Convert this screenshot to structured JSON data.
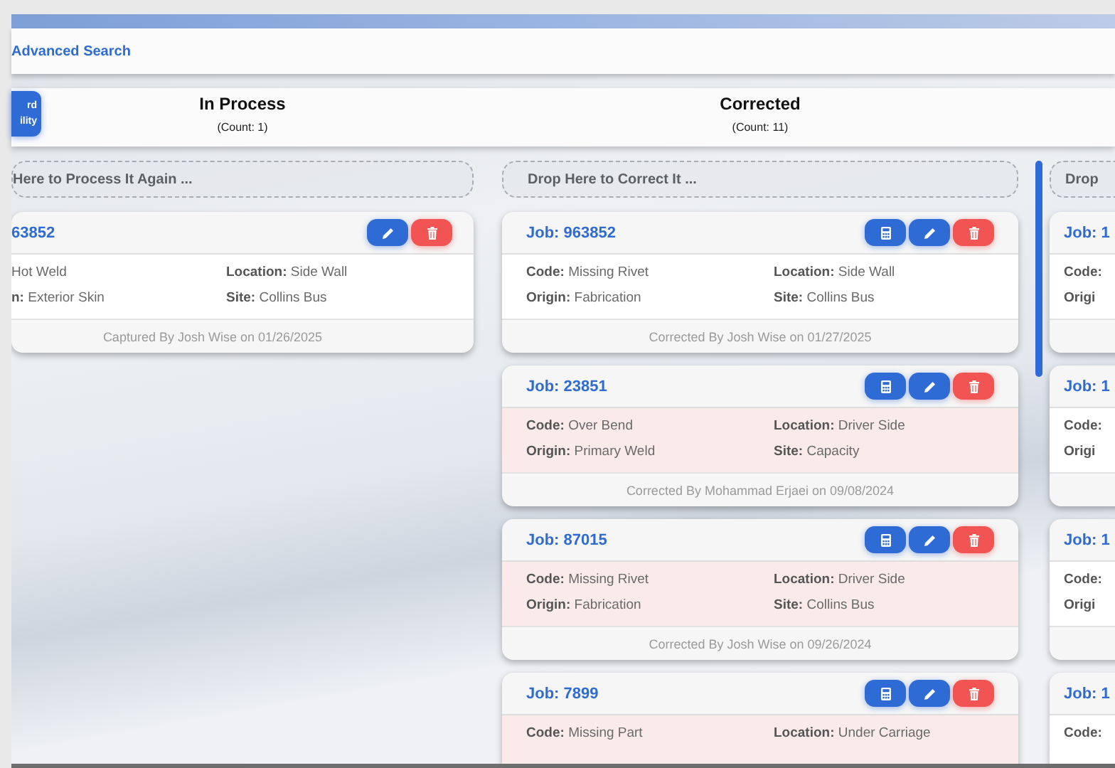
{
  "top_bar": {
    "link": "Advanced Search"
  },
  "side_button": {
    "lines": [
      "rd",
      "ility"
    ]
  },
  "columns": [
    {
      "title": "In Process",
      "count": "(Count: 1)",
      "drop_hint": "Here to Process It Again ...",
      "cards": [
        {
          "title": "63852",
          "highlighted": false,
          "actions": [
            {
              "kind": "edit"
            },
            {
              "kind": "delete"
            }
          ],
          "rows": [
            [
              {
                "value": "Hot Weld"
              },
              {
                "label": "Location:",
                "value": "Side Wall"
              }
            ],
            [
              {
                "label": "n:",
                "value": "Exterior Skin"
              },
              {
                "label": "Site:",
                "value": "Collins Bus"
              }
            ]
          ],
          "footer": "Captured By Josh Wise on 01/26/2025"
        }
      ]
    },
    {
      "title": "Corrected",
      "count": "(Count: 11)",
      "drop_hint": "Drop Here to Correct It ...",
      "cards": [
        {
          "title": "Job: 963852",
          "highlighted": false,
          "actions": [
            {
              "kind": "calculate"
            },
            {
              "kind": "edit"
            },
            {
              "kind": "delete"
            }
          ],
          "rows": [
            [
              {
                "label": "Code:",
                "value": "Missing Rivet"
              },
              {
                "label": "Location:",
                "value": "Side Wall"
              }
            ],
            [
              {
                "label": "Origin:",
                "value": "Fabrication"
              },
              {
                "label": "Site:",
                "value": "Collins Bus"
              }
            ]
          ],
          "footer": "Corrected By Josh Wise on 01/27/2025"
        },
        {
          "title": "Job: 23851",
          "highlighted": true,
          "actions": [
            {
              "kind": "calculate"
            },
            {
              "kind": "edit"
            },
            {
              "kind": "delete"
            }
          ],
          "rows": [
            [
              {
                "label": "Code:",
                "value": "Over Bend"
              },
              {
                "label": "Location:",
                "value": "Driver Side"
              }
            ],
            [
              {
                "label": "Origin:",
                "value": "Primary Weld"
              },
              {
                "label": "Site:",
                "value": "Capacity"
              }
            ]
          ],
          "footer": "Corrected By Mohammad Erjaei on 09/08/2024"
        },
        {
          "title": "Job: 87015",
          "highlighted": true,
          "actions": [
            {
              "kind": "calculate"
            },
            {
              "kind": "edit"
            },
            {
              "kind": "delete"
            }
          ],
          "rows": [
            [
              {
                "label": "Code:",
                "value": "Missing Rivet"
              },
              {
                "label": "Location:",
                "value": "Driver Side"
              }
            ],
            [
              {
                "label": "Origin:",
                "value": "Fabrication"
              },
              {
                "label": "Site:",
                "value": "Collins Bus"
              }
            ]
          ],
          "footer": "Corrected By Josh Wise on 09/26/2024"
        },
        {
          "title": "Job: 7899",
          "highlighted": true,
          "actions": [
            {
              "kind": "calculate"
            },
            {
              "kind": "edit"
            },
            {
              "kind": "delete"
            }
          ],
          "rows": [
            [
              {
                "label": "Code:",
                "value": "Missing Part"
              },
              {
                "label": "Location:",
                "value": "Under Carriage"
              }
            ]
          ]
        }
      ]
    },
    {
      "drop_hint": "Drop",
      "cards": [
        {
          "title": "Job: 1",
          "highlighted": false,
          "rows": [
            [
              {
                "label": "Code:"
              }
            ],
            [
              {
                "label": "Origi"
              }
            ]
          ]
        },
        {
          "title": "Job: 1",
          "highlighted": false,
          "rows": [
            [
              {
                "label": "Code:"
              }
            ],
            [
              {
                "label": "Origi"
              }
            ]
          ]
        },
        {
          "title": "Job: 1",
          "highlighted": false,
          "rows": [
            [
              {
                "label": "Code:"
              }
            ],
            [
              {
                "label": "Origi"
              }
            ]
          ]
        },
        {
          "title": "Job: 1",
          "highlighted": false,
          "rows": [
            [
              {
                "label": "Code:"
              }
            ]
          ]
        }
      ]
    }
  ]
}
